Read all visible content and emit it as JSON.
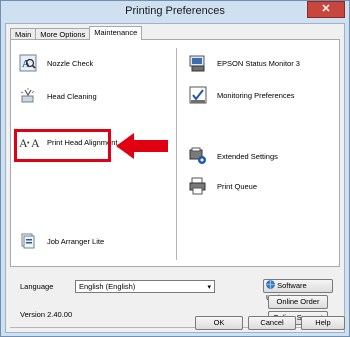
{
  "window": {
    "title": "Printing Preferences",
    "close_glyph": "✕"
  },
  "tabs": [
    {
      "label": "Main"
    },
    {
      "label": "More Options"
    },
    {
      "label": "Maintenance"
    }
  ],
  "left_items": [
    {
      "label": "Nozzle Check",
      "icon": "nozzle-check-icon"
    },
    {
      "label": "Head Cleaning",
      "icon": "head-cleaning-icon"
    },
    {
      "label": "Print Head Alignment",
      "icon": "print-head-alignment-icon"
    },
    {
      "label": "Job Arranger Lite",
      "icon": "job-arranger-icon"
    }
  ],
  "right_items": [
    {
      "label": "EPSON Status Monitor 3",
      "icon": "status-monitor-icon"
    },
    {
      "label": "Monitoring Preferences",
      "icon": "monitoring-preferences-icon"
    },
    {
      "label": "Extended Settings",
      "icon": "extended-settings-icon"
    },
    {
      "label": "Print Queue",
      "icon": "print-queue-icon"
    }
  ],
  "language": {
    "label": "Language",
    "value": "English (English)"
  },
  "version": "Version 2.40.00",
  "buttons": {
    "software_update": "Software Update",
    "online_order": "Online Order",
    "online_support": "Online Support",
    "ok": "OK",
    "cancel": "Cancel",
    "help": "Help"
  },
  "colors": {
    "highlight": "#e00012",
    "accent": "#1e5aa8"
  }
}
